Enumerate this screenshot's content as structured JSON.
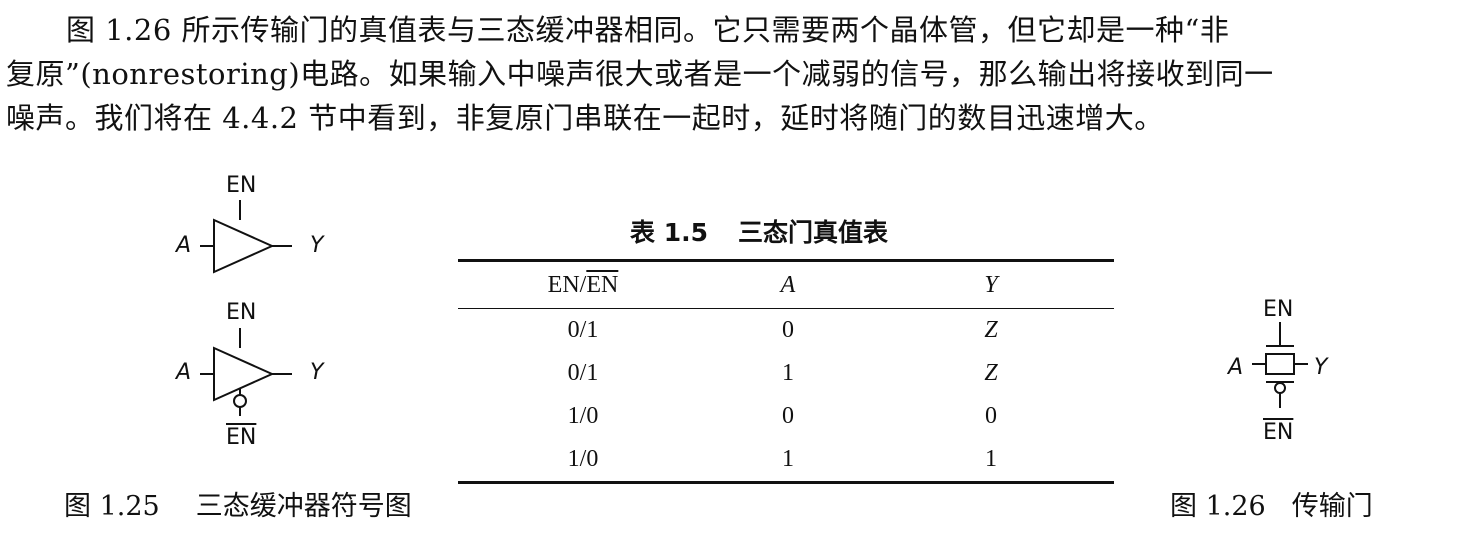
{
  "paragraph": {
    "line1": "图 1.26 所示传输门的真值表与三态缓冲器相同。它只需要两个晶体管，但它却是一种“非",
    "line2": "复原”(nonrestoring)电路。如果输入中噪声很大或者是一个减弱的信号，那么输出将接收到同一",
    "line3": "噪声。我们将在 4.4.2 节中看到，非复原门串联在一起时，延时将随门的数目迅速增大。"
  },
  "fig125": {
    "top_gate": {
      "en": "EN",
      "input": "A",
      "output": "Y"
    },
    "bottom_gate": {
      "en": "EN",
      "input": "A",
      "output": "Y",
      "en_bar": "EN"
    },
    "caption_number": "图 1.25",
    "caption_text": "三态缓冲器符号图"
  },
  "table15": {
    "title_number": "表 1.5",
    "title_text": "三态门真值表",
    "headers": {
      "en_plain": "EN/",
      "en_bar": "EN",
      "a": "A",
      "y": "Y"
    },
    "rows": [
      {
        "en": "0/1",
        "a": "0",
        "y": "Z"
      },
      {
        "en": "0/1",
        "a": "1",
        "y": "Z"
      },
      {
        "en": "1/0",
        "a": "0",
        "y": "0"
      },
      {
        "en": "1/0",
        "a": "1",
        "y": "1"
      }
    ]
  },
  "fig126": {
    "en": "EN",
    "input": "A",
    "output": "Y",
    "en_bar": "EN",
    "caption_number": "图 1.26",
    "caption_text": "传输门"
  }
}
